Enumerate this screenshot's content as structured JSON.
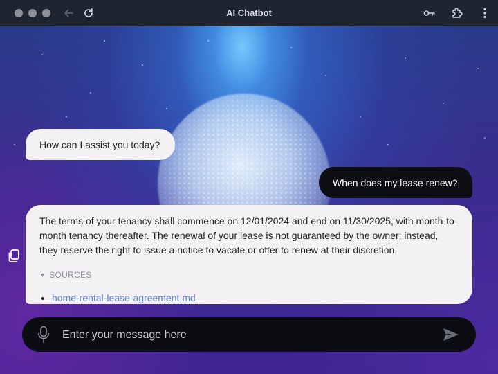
{
  "window": {
    "title": "AI Chatbot"
  },
  "titlebar": {
    "icons": [
      "close-dot",
      "minimize-dot",
      "maximize-dot",
      "back-arrow-icon",
      "reload-icon",
      "key-icon",
      "extension-icon",
      "more-vertical-icon"
    ]
  },
  "chat": {
    "messages": [
      {
        "role": "assistant",
        "text": "How can I assist you today?"
      },
      {
        "role": "user",
        "text": "When does my lease renew?"
      },
      {
        "role": "assistant",
        "text": "The terms of your tenancy shall commence on 12/01/2024 and end on 11/30/2025, with month-to-month tenancy thereafter. The renewal of your lease is not guaranteed by the owner; instead, they reserve the right to issue a notice to vacate or offer to renew at their discretion.",
        "sources_label": "SOURCES",
        "sources": [
          "home-rental-lease-agreement.md"
        ]
      }
    ],
    "copy_icon": "copy-icon"
  },
  "composer": {
    "placeholder": "Enter your message here",
    "value": "",
    "mic_icon": "microphone-icon",
    "send_icon": "send-icon"
  },
  "colors": {
    "titlebar": "#1f2431",
    "bot_bubble": "#f4f1f5",
    "user_bubble": "#0d0f14",
    "link": "#5d82d4",
    "input_bar": "#0b0d13"
  }
}
